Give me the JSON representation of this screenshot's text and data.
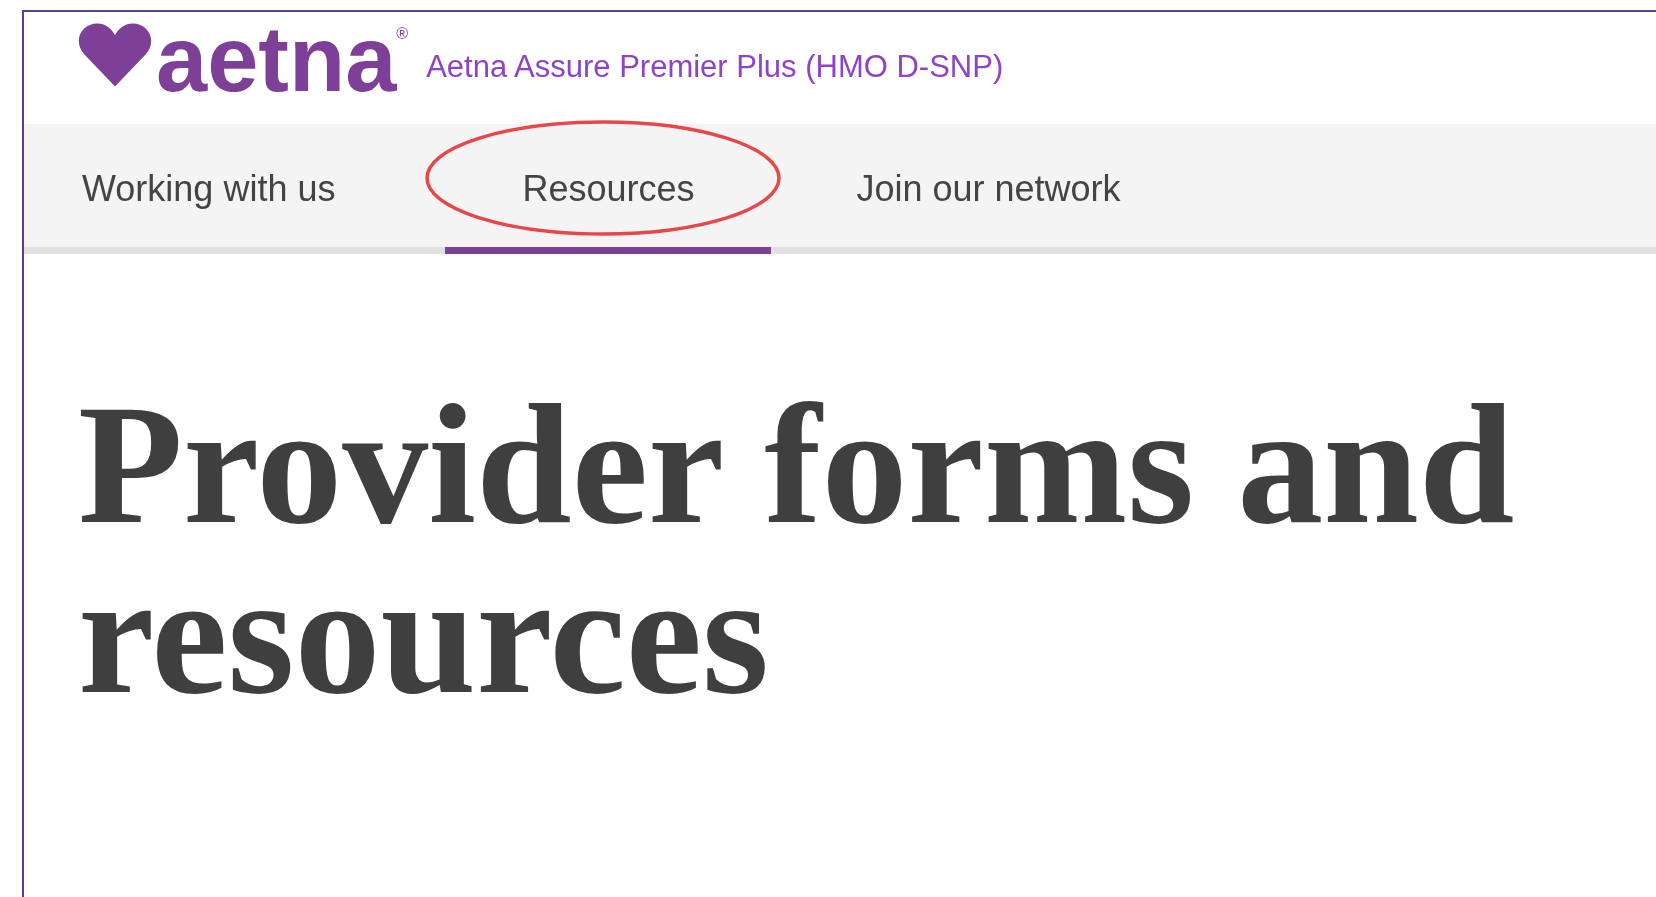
{
  "header": {
    "wordmark": "aetna",
    "registered": "®",
    "plan_name": "Aetna Assure Premier Plus (HMO D-SNP)"
  },
  "nav": {
    "tabs": [
      {
        "label": "Working with us",
        "selected": false,
        "circled": false
      },
      {
        "label": "Resources",
        "selected": true,
        "circled": true
      },
      {
        "label": "Join our network",
        "selected": false,
        "circled": false
      }
    ]
  },
  "heading": "Provider forms and resources"
}
